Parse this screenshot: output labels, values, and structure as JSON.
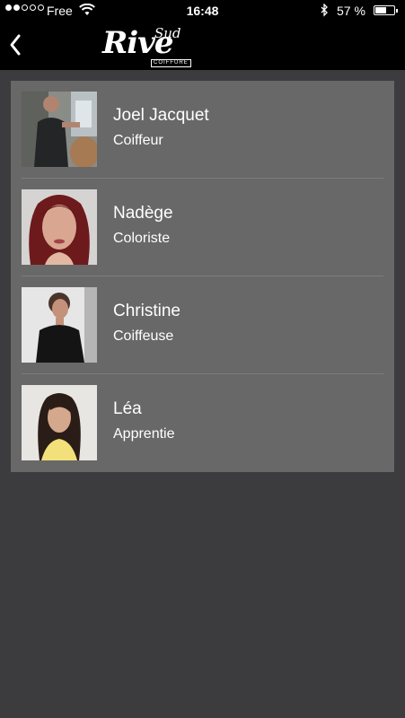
{
  "status_bar": {
    "carrier": "Free",
    "time": "16:48",
    "battery_percent": "57 %",
    "battery_level": 0.57,
    "signal_bars_filled": 2,
    "signal_bars_total": 5
  },
  "header": {
    "logo_main": "Rive",
    "logo_sub": "Sud",
    "logo_tagline": "COIFFURE"
  },
  "team": [
    {
      "name": "Joel Jacquet",
      "role": "Coiffeur"
    },
    {
      "name": "Nadège",
      "role": "Coloriste"
    },
    {
      "name": "Christine",
      "role": "Coiffeuse"
    },
    {
      "name": "Léa",
      "role": "Apprentie"
    }
  ],
  "colors": {
    "background": "#3c3b3d",
    "list_background": "#686868",
    "bar_background": "#000000",
    "text": "#ffffff"
  }
}
